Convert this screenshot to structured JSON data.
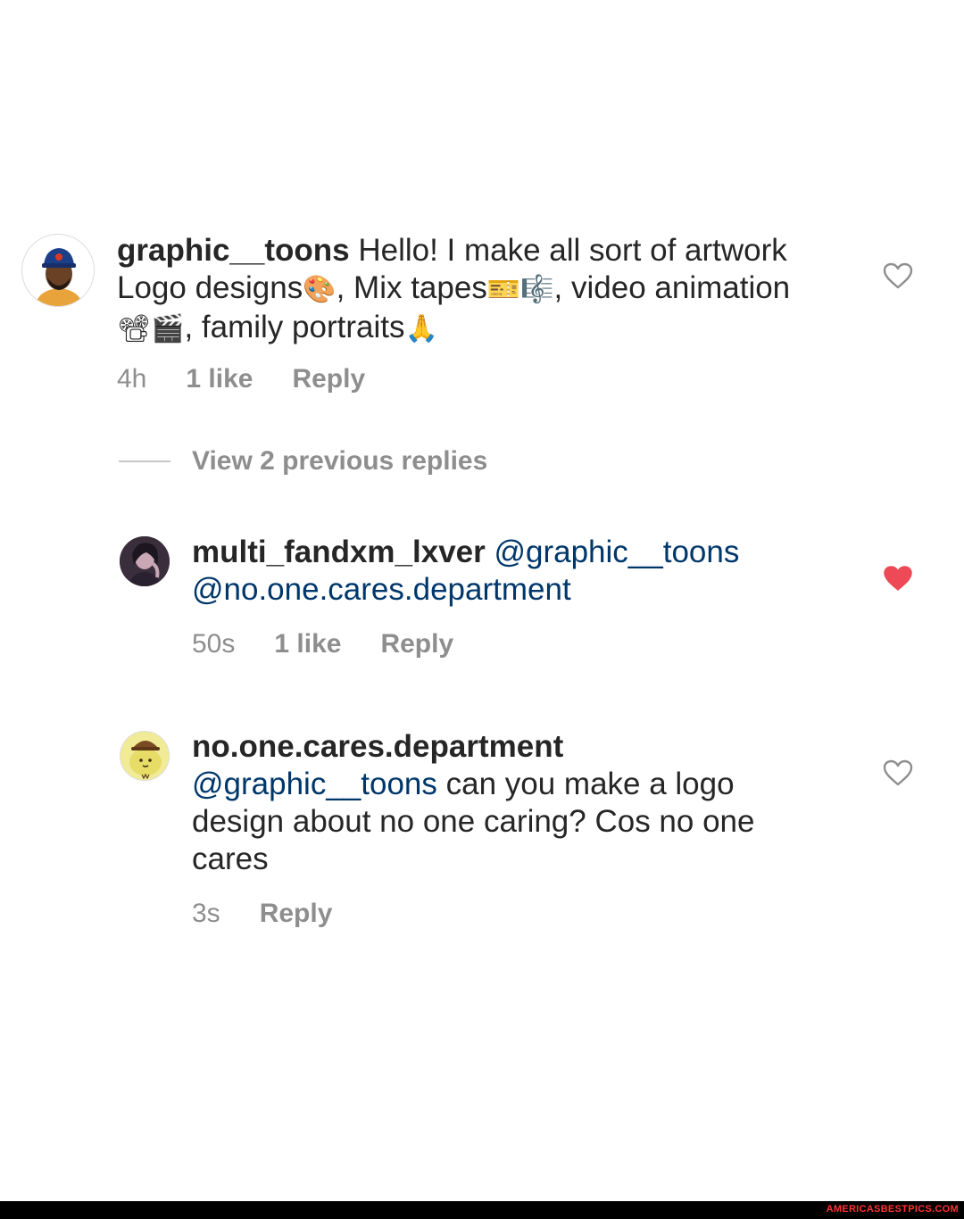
{
  "comments": [
    {
      "username": "graphic__toons",
      "text_1": " Hello! I make all sort of artwork Logo designs",
      "emoji_1": "🎨",
      "text_2": ", Mix tapes",
      "emoji_2": "🎫🎼",
      "text_3": ", video animation",
      "emoji_3": "📽🎬",
      "text_4": ", family portraits",
      "emoji_4": "🙏",
      "time": "4h",
      "likes": "1 like",
      "reply": "Reply",
      "liked": false
    },
    {
      "username": "multi_fandxm_lxver",
      "mention_1": " @graphic__toons",
      "mention_2": "@no.one.cares.department",
      "time": "50s",
      "likes": "1 like",
      "reply": "Reply",
      "liked": true
    },
    {
      "username": "no.one.cares.department",
      "mention_1": "@graphic__toons",
      "text_1": " can you make a logo design about no one caring? Cos no one cares",
      "time": "3s",
      "reply": "Reply",
      "liked": false
    }
  ],
  "view_replies": "View 2 previous replies",
  "watermark": "AMERICASBESTPICS.COM",
  "colors": {
    "text": "#262626",
    "meta": "#8e8e8e",
    "mention": "#00376b",
    "heart_liked": "#ed4956",
    "heart_outline": "#8e8e8e"
  },
  "icons": {
    "heart_outline": "heart-outline-icon",
    "heart_filled": "heart-filled-icon"
  }
}
